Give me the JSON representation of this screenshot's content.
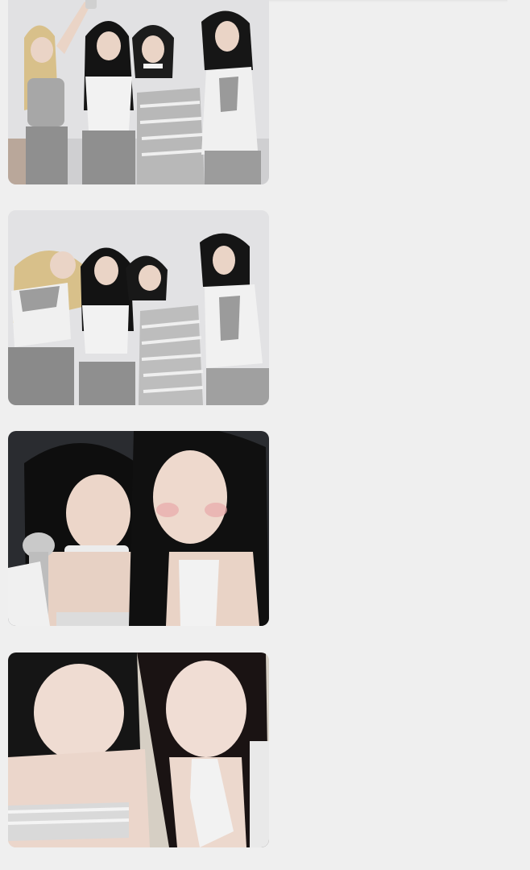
{
  "feed": {
    "images": [
      {
        "subject": "four-members-group-photo-1"
      },
      {
        "subject": "four-members-group-photo-2"
      },
      {
        "subject": "two-members-selfie-with-microphone"
      },
      {
        "subject": "two-members-close-up-selfie"
      }
    ]
  },
  "colors": {
    "page_background": "#efefef",
    "photo_wall": "#dcdcde",
    "outfit_white": "#f2f2f2",
    "camo_gray": "#8f8f8f",
    "hair_black": "#141414",
    "hair_blonde": "#d8c08a",
    "skin": "#ead4c6",
    "stage_dark": "#2a2c30"
  }
}
